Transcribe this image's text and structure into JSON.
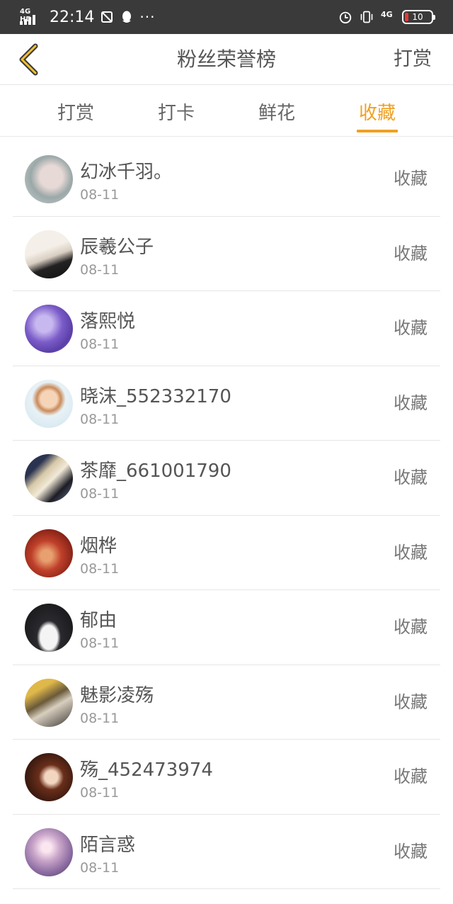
{
  "status_bar": {
    "network_left": "4G HD",
    "time": "22:14",
    "more": "···",
    "network_right": "4G",
    "battery": "10"
  },
  "header": {
    "title": "粉丝荣誉榜",
    "action": "打赏"
  },
  "tabs": [
    {
      "label": "打赏",
      "active": false
    },
    {
      "label": "打卡",
      "active": false
    },
    {
      "label": "鲜花",
      "active": false
    },
    {
      "label": "收藏",
      "active": true
    }
  ],
  "accent_color": "#f0a020",
  "fans": [
    {
      "name": "幻冰千羽。",
      "date": "08-11",
      "action": "收藏"
    },
    {
      "name": "辰羲公子",
      "date": "08-11",
      "action": "收藏"
    },
    {
      "name": "落熙悦",
      "date": "08-11",
      "action": "收藏"
    },
    {
      "name": "晓沫_552332170",
      "date": "08-11",
      "action": "收藏"
    },
    {
      "name": "茶靡_661001790",
      "date": "08-11",
      "action": "收藏"
    },
    {
      "name": "烟桦",
      "date": "08-11",
      "action": "收藏"
    },
    {
      "name": "郁由",
      "date": "08-11",
      "action": "收藏"
    },
    {
      "name": "魅影凌殇",
      "date": "08-11",
      "action": "收藏"
    },
    {
      "name": "殇_452473974",
      "date": "08-11",
      "action": "收藏"
    },
    {
      "name": "陌言惑",
      "date": "08-11",
      "action": "收藏"
    }
  ]
}
